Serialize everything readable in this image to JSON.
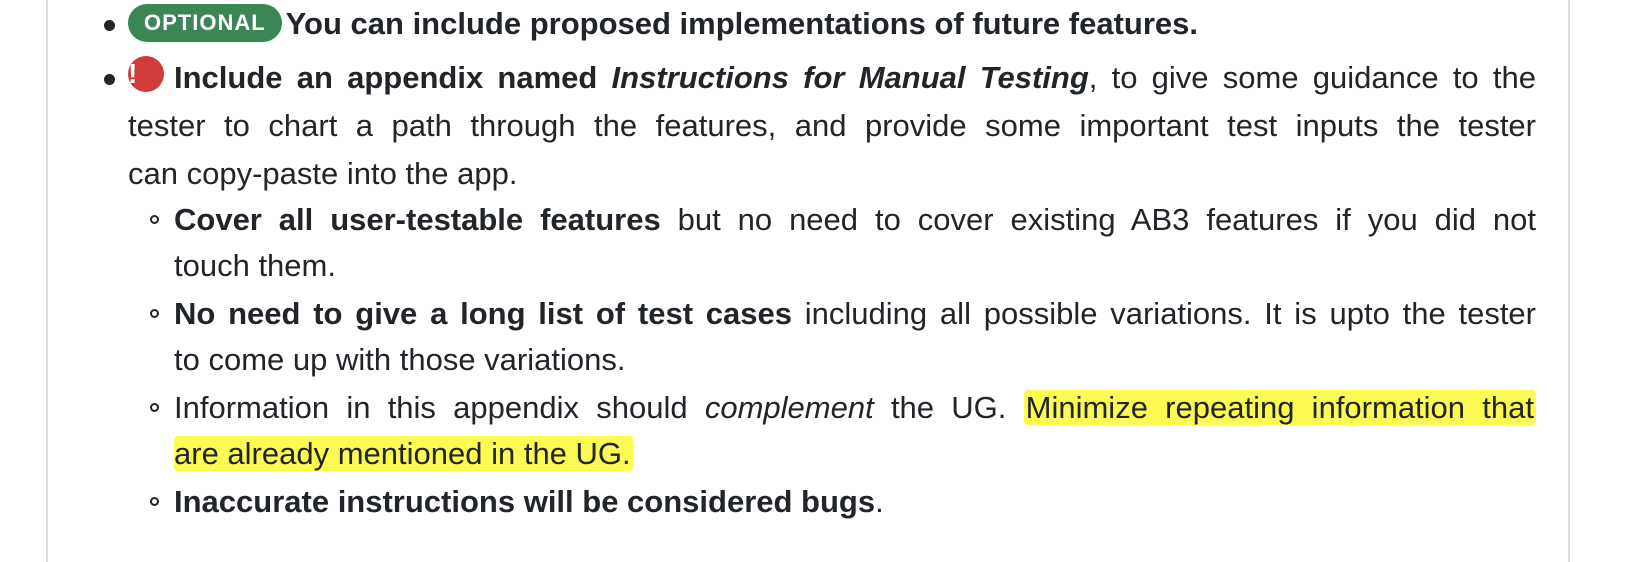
{
  "items": {
    "optional": {
      "badge": "OPTIONAL",
      "text": "You can include proposed implementations of future features."
    },
    "appendix": {
      "icon": "!",
      "bold_start": "Include an appendix named ",
      "bold_italic": "Instructions for Manual Testing",
      "rest_line1": ", to give some guidance to the",
      "line2": "tester to chart a path through the features, and provide some important test inputs the tester",
      "line3": "can copy-paste into the app."
    },
    "sub1": {
      "bold": "Cover all user-testable features",
      "rest_line1": " but no need to cover existing AB3 features if you did not",
      "line2": "touch them."
    },
    "sub2": {
      "bold": "No need to give a long list of test cases",
      "rest_line1": " including all possible variations. It is upto the tester",
      "line2": "to come up with those variations."
    },
    "sub3": {
      "text_start": "Information in this appendix should ",
      "italic": "complement",
      "text_mid": " the UG. ",
      "highlight_line1": "Minimize repeating information that",
      "highlight_line2": "are already mentioned in the UG."
    },
    "sub4": {
      "bold": "Inaccurate instructions will be considered bugs",
      "end": "."
    }
  },
  "colors": {
    "optional_badge": "#3c8656",
    "alert_icon": "#d13b3b",
    "highlight": "#fbfb51",
    "text": "#212529"
  }
}
